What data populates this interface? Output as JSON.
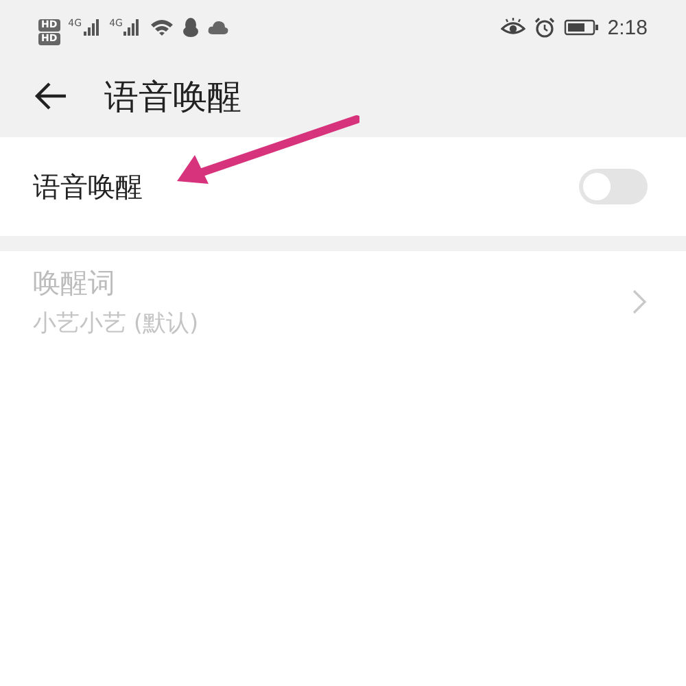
{
  "status_bar": {
    "hd_badges": [
      "HD",
      "HD"
    ],
    "signals": [
      {
        "network": "4G"
      },
      {
        "network": "4G"
      }
    ],
    "time": "2:18"
  },
  "header": {
    "title": "语音唤醒"
  },
  "settings": [
    {
      "kind": "switch",
      "label": "语音唤醒",
      "on": false
    },
    {
      "kind": "link",
      "label": "唤醒词",
      "value": "小艺小艺 (默认)",
      "disabled": true
    }
  ],
  "annotations": [
    {
      "kind": "arrow"
    }
  ]
}
